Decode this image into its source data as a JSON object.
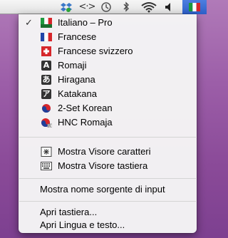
{
  "menubar": {
    "icons": [
      "dropbox-icon",
      "remote-display-icon",
      "time-machine-icon",
      "bluetooth-icon",
      "wifi-icon",
      "volume-icon",
      "input-source-flag-icon"
    ]
  },
  "menu": {
    "sources": [
      {
        "label": "Italiano – Pro",
        "icon": "italian-pro-flag-icon",
        "checked": true,
        "check_glyph": "✓"
      },
      {
        "label": "Francese",
        "icon": "french-flag-icon"
      },
      {
        "label": "Francese svizzero",
        "icon": "swiss-flag-icon"
      },
      {
        "label": "Romaji",
        "icon": "romaji-icon",
        "glyph": "A"
      },
      {
        "label": "Hiragana",
        "icon": "hiragana-icon",
        "glyph": "あ"
      },
      {
        "label": "Katakana",
        "icon": "katakana-icon",
        "glyph": "ア"
      },
      {
        "label": "2-Set Korean",
        "icon": "korean-flag-icon"
      },
      {
        "label": "HNC Romaja",
        "icon": "korean-romaja-flag-icon"
      }
    ],
    "viewers": [
      {
        "label": "Mostra Visore caratteri",
        "icon": "character-viewer-icon"
      },
      {
        "label": "Mostra Visore tastiera",
        "icon": "keyboard-viewer-icon"
      }
    ],
    "show_source_name": "Mostra nome sorgente di input",
    "open_keyboard": "Apri tastiera...",
    "open_language": "Apri Lingua e testo..."
  }
}
